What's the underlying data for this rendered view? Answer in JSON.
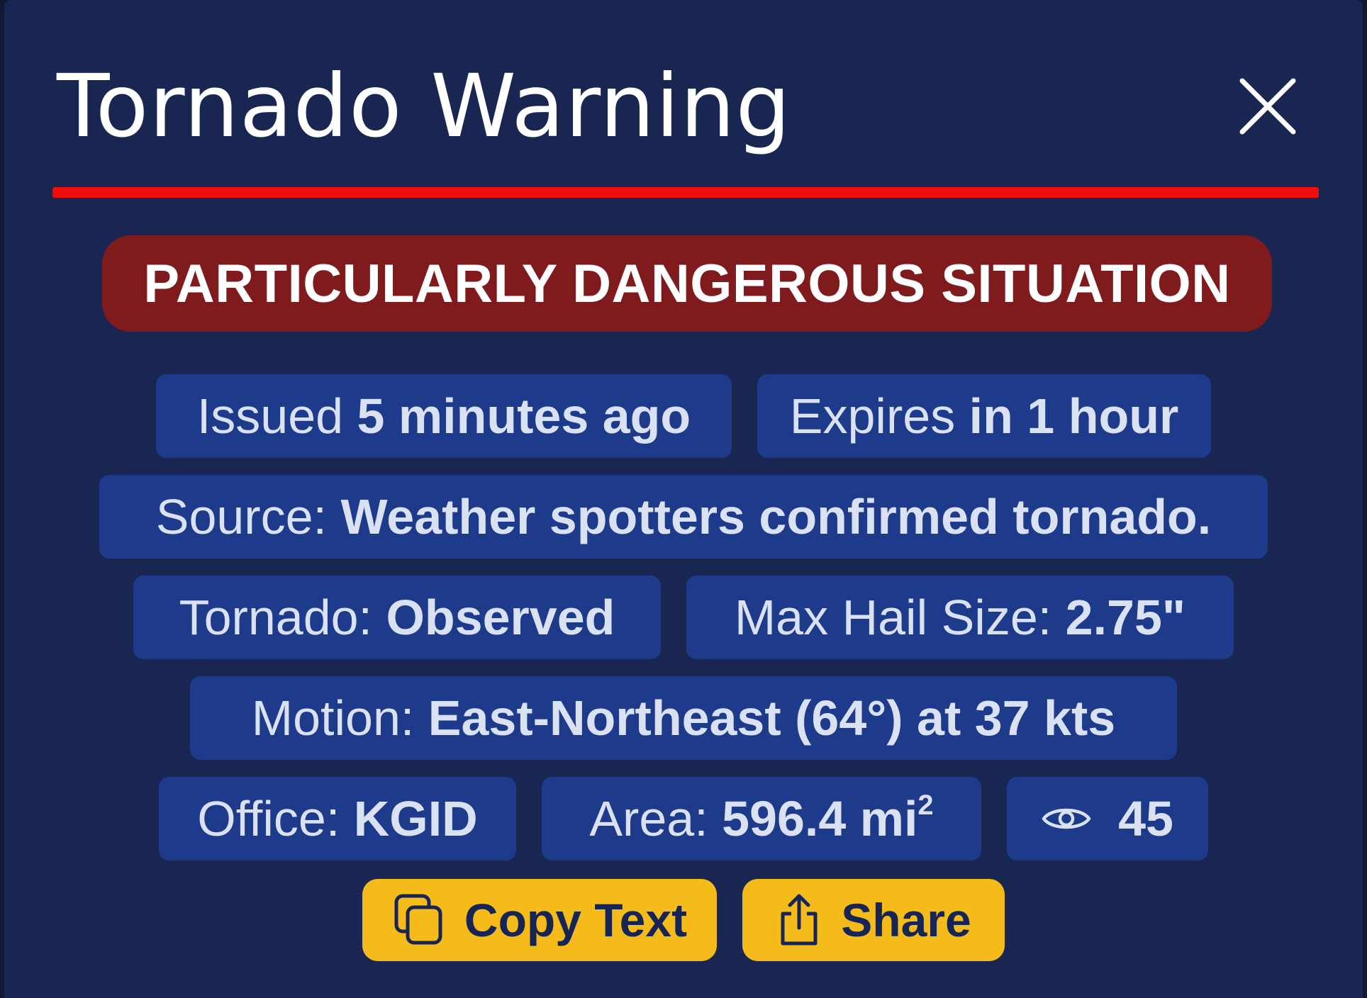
{
  "dialog": {
    "title": "Tornado Warning",
    "close_icon": "close-icon"
  },
  "colors": {
    "panel_bg": "#182651",
    "chip_bg": "#1e3a8a",
    "accent_red": "#ee0e0e",
    "pds_bg": "#7f1a1d",
    "button_yellow": "#f5bb1b",
    "button_text": "#172554"
  },
  "alert": {
    "banner": "PARTICULARLY DANGEROUS SITUATION"
  },
  "details": {
    "issued_label": "Issued",
    "issued_value": "5 minutes ago",
    "expires_label": "Expires",
    "expires_value": "in 1 hour",
    "source_label": "Source:",
    "source_value": "Weather spotters confirmed tornado.",
    "tornado_label": "Tornado:",
    "tornado_value": "Observed",
    "hail_label": "Max Hail Size:",
    "hail_value": "2.75\"",
    "motion_label": "Motion:",
    "motion_value": "East-Northeast (64°) at 37 kts",
    "office_label": "Office:",
    "office_value": "KGID",
    "area_label": "Area:",
    "area_value": "596.4 mi",
    "area_unit_sup": "2",
    "views_icon": "eye-icon",
    "views_value": "45"
  },
  "actions": {
    "copy_label": "Copy Text",
    "copy_icon": "copy-icon",
    "share_label": "Share",
    "share_icon": "share-icon"
  }
}
